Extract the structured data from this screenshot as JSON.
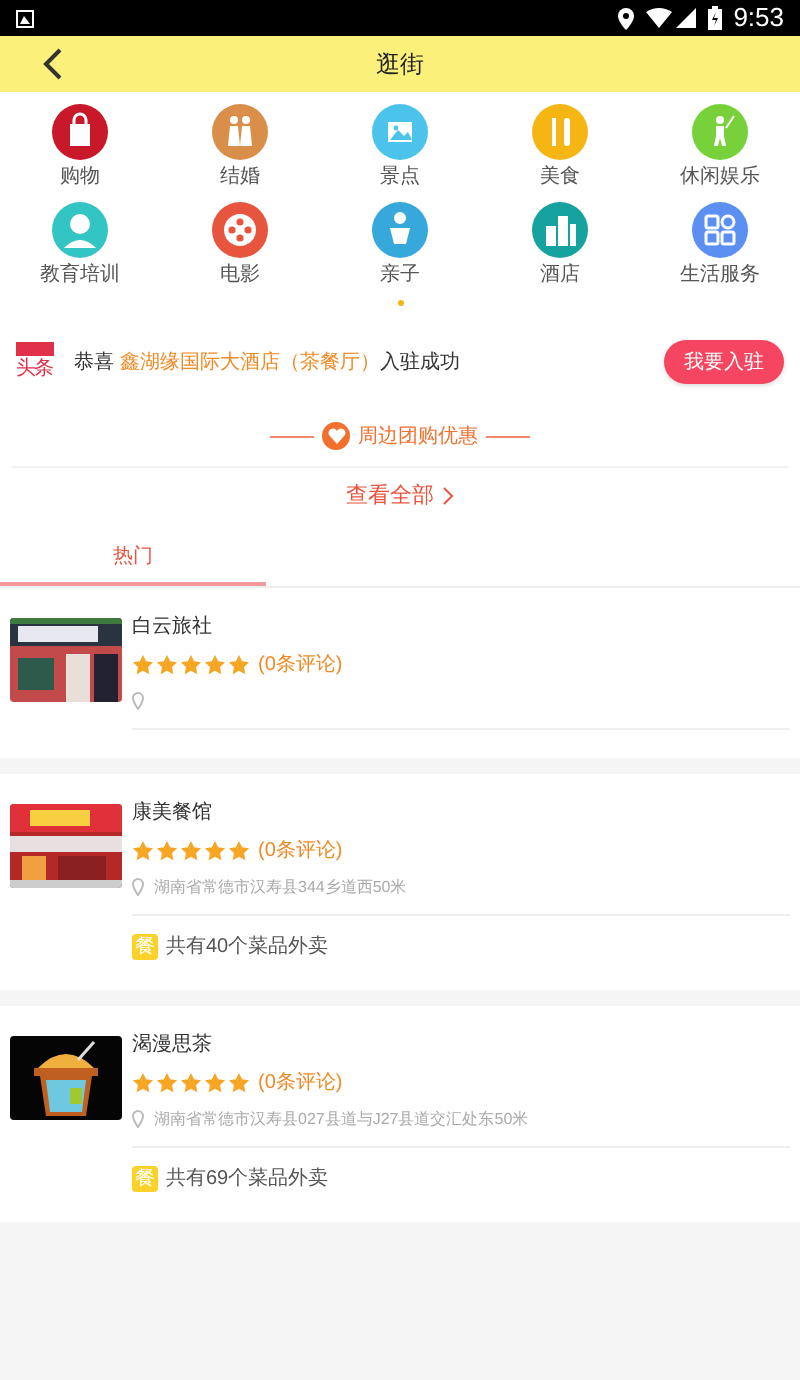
{
  "status_bar": {
    "time": "9:53"
  },
  "header": {
    "title": "逛街"
  },
  "categories": [
    {
      "label": "购物",
      "color": "#c9182a"
    },
    {
      "label": "结婚",
      "color": "#d98f4a"
    },
    {
      "label": "景点",
      "color": "#4cc3ea"
    },
    {
      "label": "美食",
      "color": "#f5b614"
    },
    {
      "label": "休闲娱乐",
      "color": "#78d13a"
    },
    {
      "label": "教育培训",
      "color": "#33c4c4"
    },
    {
      "label": "电影",
      "color": "#e8553f"
    },
    {
      "label": "亲子",
      "color": "#36a8dc"
    },
    {
      "label": "酒店",
      "color": "#16a3a0"
    },
    {
      "label": "生活服务",
      "color": "#5b8ff2"
    }
  ],
  "notice": {
    "logo": "头条",
    "text": "恭喜 **鑫湖缘国际大酒店（茶餐厅）**入驻成功",
    "button": "我要入驻"
  },
  "section_title": "周边团购优惠",
  "view_all": "查看全部",
  "tabs": [
    {
      "label": "热门",
      "selected": true
    }
  ],
  "listings": [
    {
      "name": "白云旅社",
      "stars": 5,
      "reviews": "(0条评论)"
    },
    {
      "name": "康美餐馆",
      "stars": 5,
      "reviews": "(0条评论)",
      "address": "湖南省常德市汉寿县344乡道西50米",
      "badge": "餐",
      "delivery": "共有40个菜品外卖"
    },
    {
      "name": "渴漫思茶",
      "stars": 5,
      "reviews": "(0条评论)",
      "address": "湖南省常德市汉寿县027县道与J27县道交汇处东50米",
      "badge": "餐",
      "delivery": "共有69个菜品外卖"
    }
  ]
}
